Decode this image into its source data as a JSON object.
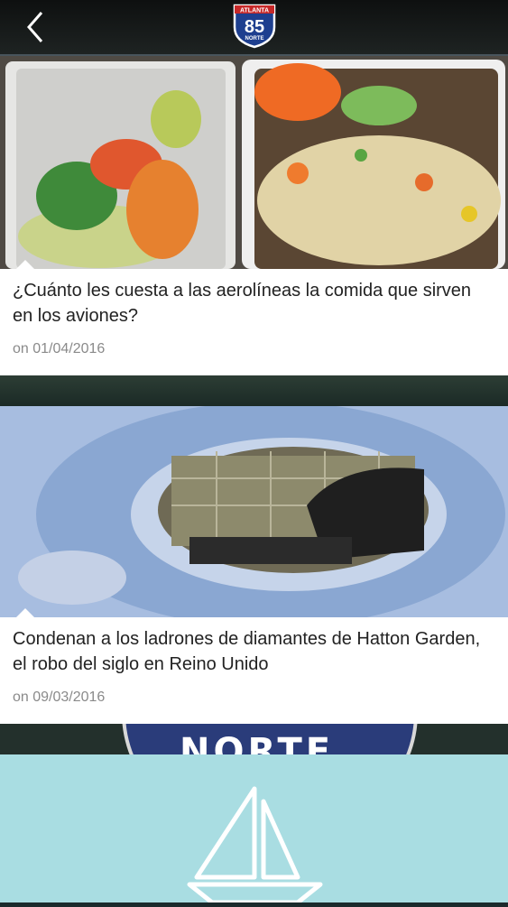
{
  "header": {
    "back_icon": "chevron-left-icon",
    "logo": {
      "top": "ATLANTA",
      "number": "85",
      "bottom": "NORTE"
    }
  },
  "background": {
    "shield_text": "NORTE"
  },
  "articles": [
    {
      "title": "¿Cuánto les cuesta a las aerolíneas la comida que sirven en los aviones?",
      "date": "on 01/04/2016",
      "image": "airline-meal-tray"
    },
    {
      "title": "Condenan a los ladrones de diamantes de Hatton Garden, el robo del siglo en Reino Unido",
      "date": "on 09/03/2016",
      "image": "drilled-vault-hole"
    },
    {
      "title": "",
      "date": "",
      "image": "sailboat-icon"
    }
  ]
}
